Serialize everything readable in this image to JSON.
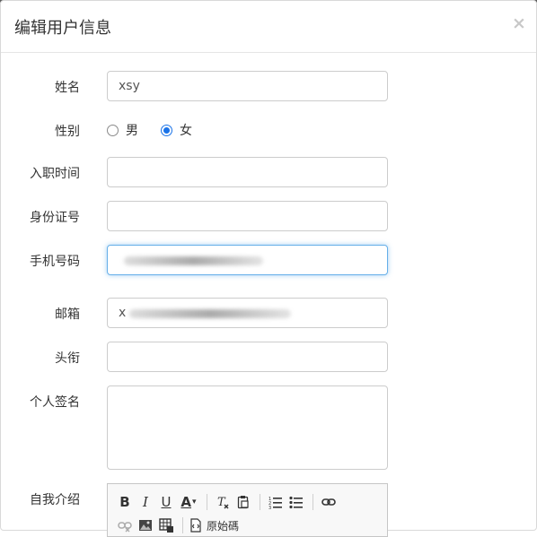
{
  "modal": {
    "title": "编辑用户信息",
    "close": "×"
  },
  "fields": {
    "name": {
      "label": "姓名",
      "value": "xsy"
    },
    "gender": {
      "label": "性别",
      "options": [
        "男",
        "女"
      ],
      "selected": "女"
    },
    "hire_date": {
      "label": "入职时间",
      "value": ""
    },
    "id_number": {
      "label": "身份证号",
      "value": ""
    },
    "phone": {
      "label": "手机号码",
      "value": ""
    },
    "email": {
      "label": "邮箱",
      "value": "x"
    },
    "title": {
      "label": "头衔",
      "value": ""
    },
    "signature": {
      "label": "个人签名",
      "value": ""
    },
    "intro": {
      "label": "自我介绍"
    }
  },
  "editor": {
    "toolbar": {
      "bold": "B",
      "italic": "I",
      "underline": "U",
      "font_color": "A",
      "source_label": "原始碼"
    }
  },
  "icons": [
    "close-icon",
    "bold-icon",
    "italic-icon",
    "underline-icon",
    "font-color-icon",
    "remove-format-icon",
    "paste-icon",
    "numbered-list-icon",
    "bullet-list-icon",
    "link-icon",
    "unlink-icon",
    "image-icon",
    "table-icon",
    "source-icon"
  ]
}
